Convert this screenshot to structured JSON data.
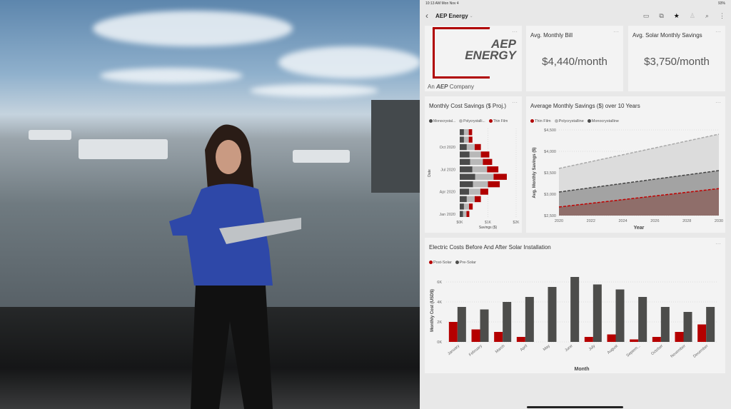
{
  "status_bar": {
    "time": "10:13 AM  Mon Nov 4",
    "battery": "93%"
  },
  "header": {
    "back_icon": "chevron-left-icon",
    "title": "AEP Energy",
    "icons": [
      "comment-icon",
      "conversation-icon",
      "favorite-star-icon",
      "person-icon",
      "search-icon",
      "more-icon"
    ]
  },
  "logo": {
    "line1": "AEP",
    "line2": "ENERGY",
    "tagline_prefix": "An",
    "tagline_brand": "AEP",
    "tagline_suffix": "Company"
  },
  "kpis": [
    {
      "title": "Avg. Monthly Bill",
      "value": "$4,440/month"
    },
    {
      "title": "Avg. Solar Monthly Savings",
      "value": "$3,750/month"
    }
  ],
  "colors": {
    "mono": "#4a4a4a",
    "poly": "#b8b8b8",
    "thin": "#b00000",
    "pre": "#4d4d4b",
    "post": "#b50000"
  },
  "chart_data": [
    {
      "type": "bar",
      "orientation": "horizontal",
      "stacked": true,
      "title": "Monthly Cost Savings ($ Proj.)",
      "xlabel": "Savings ($)",
      "ylabel": "Date",
      "xlim": [
        0,
        2000
      ],
      "xticks": [
        "$0K",
        "$1K",
        "$2K"
      ],
      "yticks": [
        "Oct 2020",
        "Jul 2020",
        "Apr 2020",
        "Jan 2020"
      ],
      "categories": [
        "Jan 2020",
        "Feb 2020",
        "Mar 2020",
        "Apr 2020",
        "May 2020",
        "Jun 2020",
        "Jul 2020",
        "Aug 2020",
        "Sep 2020",
        "Oct 2020",
        "Nov 2020",
        "Dec 2020"
      ],
      "series": [
        {
          "name": "Monocrystal...",
          "values": [
            120,
            150,
            250,
            330,
            470,
            550,
            450,
            370,
            350,
            250,
            150,
            150
          ]
        },
        {
          "name": "Polycrystalli...",
          "values": [
            120,
            180,
            280,
            400,
            530,
            650,
            520,
            450,
            400,
            280,
            170,
            170
          ]
        },
        {
          "name": "Thin Film",
          "values": [
            100,
            130,
            220,
            280,
            420,
            470,
            400,
            330,
            300,
            220,
            130,
            120
          ]
        }
      ]
    },
    {
      "type": "area",
      "title": "Average Monthly Savings ($) over 10 Years",
      "xlabel": "Year",
      "ylabel": "Avg. Monthly Savings ($)",
      "ylim": [
        2500,
        4500
      ],
      "yticks": [
        "$2,500",
        "$3,000",
        "$3,500",
        "$4,000",
        "$4,500"
      ],
      "xticks": [
        "2020",
        "2022",
        "2024",
        "2026",
        "2028",
        "2030"
      ],
      "x": [
        2020,
        2030
      ],
      "series": [
        {
          "name": "Thin Film",
          "values": [
            2700,
            3130
          ]
        },
        {
          "name": "Polycrystalline",
          "values": [
            3600,
            4400
          ]
        },
        {
          "name": "Monocrystalline",
          "values": [
            3050,
            3550
          ]
        }
      ]
    },
    {
      "type": "bar",
      "title": "Electric Costs Before And After Solar Installation",
      "xlabel": "Month",
      "ylabel": "Monthly Cost (USD$)",
      "ylim": [
        0,
        7000
      ],
      "yticks": [
        "0K",
        "2K",
        "4K",
        "6K"
      ],
      "categories": [
        "January",
        "February",
        "March",
        "April",
        "May",
        "June",
        "July",
        "August",
        "Septem...",
        "October",
        "November",
        "December"
      ],
      "series": [
        {
          "name": "Post-Solar",
          "values": [
            2000,
            1250,
            1000,
            500,
            0,
            0,
            500,
            750,
            250,
            500,
            1000,
            1750
          ]
        },
        {
          "name": "Pre-Solar",
          "values": [
            3500,
            3250,
            4000,
            4500,
            5500,
            6500,
            5750,
            5250,
            4500,
            3500,
            3000,
            3500
          ]
        }
      ]
    }
  ]
}
